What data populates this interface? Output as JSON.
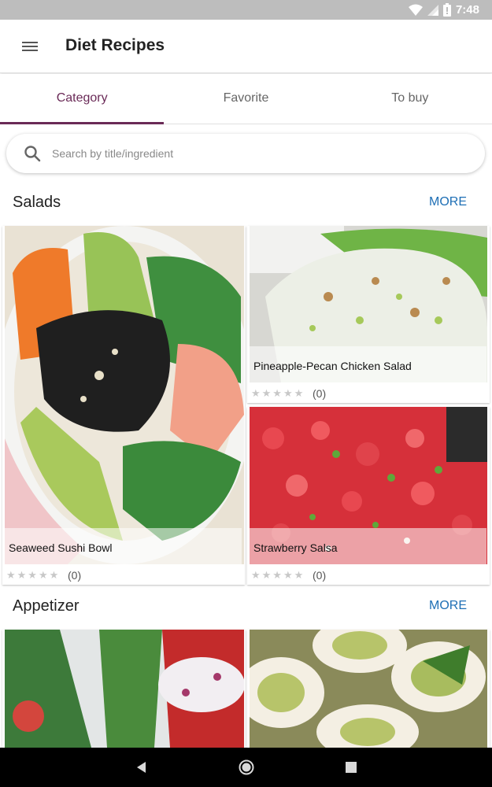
{
  "status_bar": {
    "time": "7:48",
    "icons": [
      "wifi-icon",
      "signal-icon",
      "battery-icon"
    ]
  },
  "app_bar": {
    "title": "Diet Recipes",
    "menu_icon": "hamburger-menu-icon"
  },
  "tabs": [
    {
      "label": "Category",
      "active": true
    },
    {
      "label": "Favorite",
      "active": false
    },
    {
      "label": "To buy",
      "active": false
    }
  ],
  "search": {
    "placeholder": "Search by title/ingredient",
    "value": ""
  },
  "sections": [
    {
      "title": "Salads",
      "more": "MORE",
      "recipes": [
        {
          "title": "Seaweed Sushi Bowl",
          "stars": 0,
          "count": "(0)"
        },
        {
          "title": "Pineapple-Pecan Chicken Salad",
          "stars": 0,
          "count": "(0)"
        },
        {
          "title": "Strawberry Salsa",
          "stars": 0,
          "count": "(0)"
        }
      ]
    },
    {
      "title": "Appetizer",
      "more": "MORE"
    }
  ],
  "rating_stars": "★★★★★",
  "colors": {
    "accent": "#6a2a57",
    "link": "#1e6fb5",
    "status_bar": "#bdbdbd",
    "nav_bar": "#000000"
  },
  "nav_bar": {
    "buttons": [
      "back-icon",
      "home-icon",
      "recents-icon"
    ]
  }
}
